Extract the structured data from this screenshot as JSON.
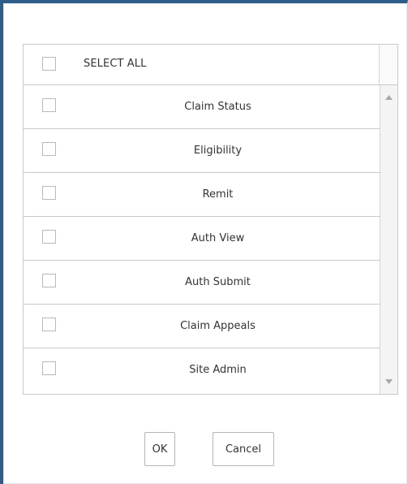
{
  "dialog": {
    "select_all_label": "SELECT ALL",
    "items": [
      {
        "label": "Claim Status",
        "checked": false
      },
      {
        "label": "Eligibility",
        "checked": false
      },
      {
        "label": "Remit",
        "checked": false
      },
      {
        "label": "Auth View",
        "checked": false
      },
      {
        "label": "Auth Submit",
        "checked": false
      },
      {
        "label": "Claim Appeals",
        "checked": false
      },
      {
        "label": "Site Admin",
        "checked": false
      }
    ],
    "ok_label": "OK",
    "cancel_label": "Cancel"
  },
  "colors": {
    "frame_accent": "#2f5d8a",
    "border": "#c9c9c9",
    "text": "#333333"
  },
  "icons": {
    "scroll_up": "triangle-up-icon",
    "scroll_down": "triangle-down-icon"
  }
}
